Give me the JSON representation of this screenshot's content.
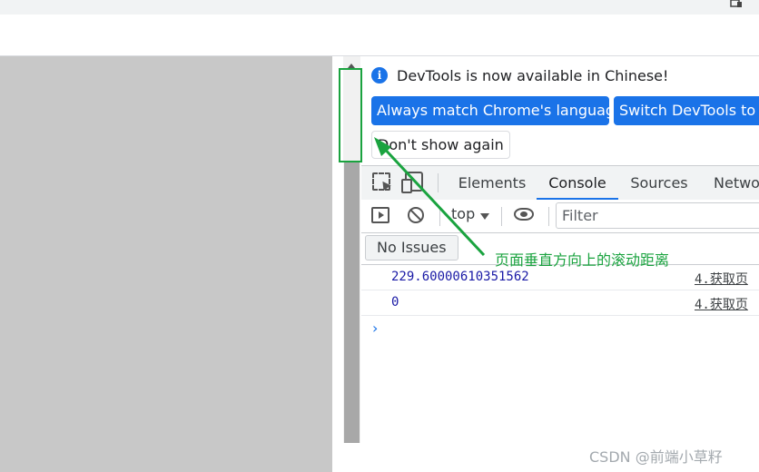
{
  "infobar": {
    "message": "DevTools is now available in Chinese!",
    "match_language_label": "Always match Chrome's language",
    "switch_label": "Switch DevTools to Chinese",
    "dont_show_label": "Don't show again"
  },
  "tabs": [
    {
      "label": "Elements"
    },
    {
      "label": "Console",
      "active": true
    },
    {
      "label": "Sources"
    },
    {
      "label": "Network"
    }
  ],
  "toolbar": {
    "context": "top",
    "filter_placeholder": "Filter"
  },
  "issues": {
    "label": "No Issues"
  },
  "console": {
    "rows": [
      {
        "value": "229.60000610351562",
        "source": "4.获取页"
      },
      {
        "value": "0",
        "source": "4.获取页"
      }
    ],
    "prompt": "›"
  },
  "annotation": {
    "text": "页面垂直方向上的滚动距离",
    "color": "#1aa33f"
  },
  "watermark": "CSDN @前端小草籽",
  "colors": {
    "accent": "#1a73e8",
    "viewport": "#c8c8c8"
  }
}
